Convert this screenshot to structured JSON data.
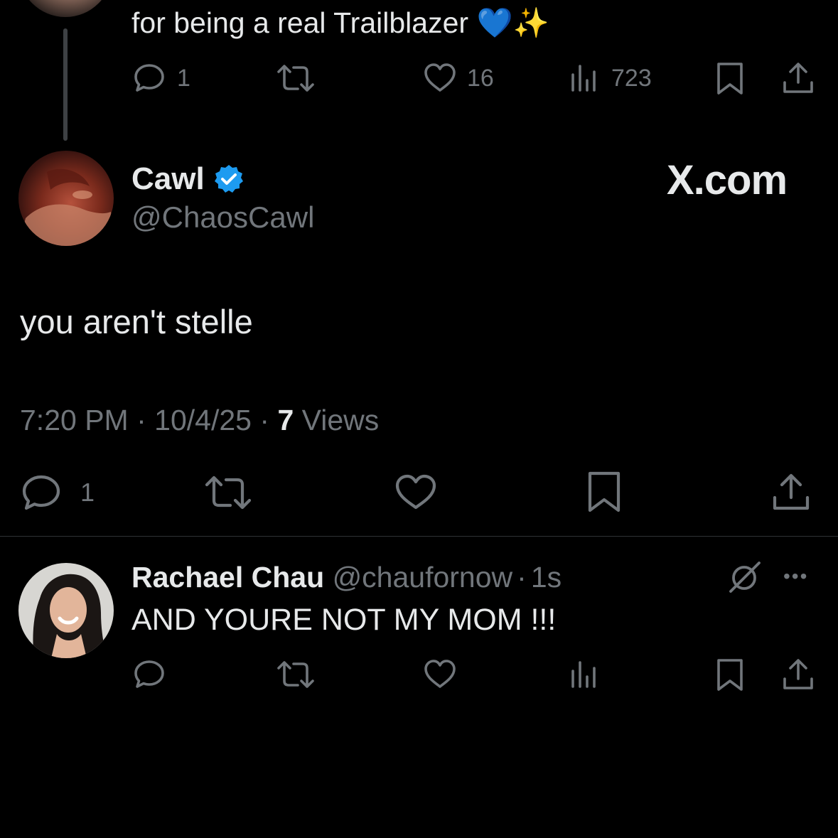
{
  "prev_tweet": {
    "text_tail": "for being a real Trailblazer",
    "emoji_1": "💙",
    "emoji_2": "✨",
    "actions": {
      "reply_count": "1",
      "like_count": "16",
      "view_count": "723"
    }
  },
  "main_tweet": {
    "author_name": "Cawl",
    "handle": "@ChaosCawl",
    "watermark": "X.com",
    "text": "you aren't stelle",
    "time": "7:20 PM",
    "date": "10/4/25",
    "separator": "·",
    "views_count": "7",
    "views_label": "Views",
    "actions": {
      "reply_count": "1"
    }
  },
  "reply": {
    "author_name": "Rachael Chau",
    "handle": "@chaufornow",
    "separator": "·",
    "time_ago": "1s",
    "text": "AND YOURE NOT MY MOM !!!",
    "more_label": "•••"
  },
  "colors": {
    "background": "#000000",
    "primary_text": "#e7e9ea",
    "secondary_text": "#71767b",
    "verified_badge": "#1d9bf0",
    "divider": "#2f3336"
  },
  "icons": [
    "reply-icon",
    "retweet-icon",
    "like-icon",
    "views-icon",
    "bookmark-icon",
    "share-icon",
    "verified-badge-icon",
    "grok-icon",
    "more-icon"
  ]
}
